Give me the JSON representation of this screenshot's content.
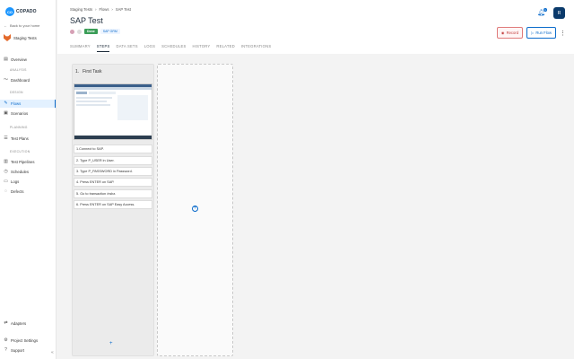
{
  "brand": {
    "logo_mark": "CO",
    "logo_text": "COPADO"
  },
  "sidebar": {
    "back_label": "Back to your home",
    "project_name": "Staging Tests",
    "sections": {
      "analysis": "ANALYSIS",
      "design": "DESIGN",
      "planning": "PLANNING",
      "execution": "EXECUTION"
    },
    "items": [
      {
        "label": "Overview",
        "icon": "overview-icon"
      },
      {
        "label": "Dashboard",
        "icon": "dashboard-icon"
      },
      {
        "label": "Flows",
        "icon": "flows-icon",
        "active": true
      },
      {
        "label": "Scenarios",
        "icon": "scenarios-icon"
      },
      {
        "label": "Test Plans",
        "icon": "test-plans-icon"
      },
      {
        "label": "Test Pipelines",
        "icon": "pipelines-icon"
      },
      {
        "label": "Schedules",
        "icon": "schedules-icon"
      },
      {
        "label": "Logs",
        "icon": "logs-icon"
      },
      {
        "label": "Defects",
        "icon": "defects-icon"
      },
      {
        "label": "Adapters",
        "icon": "adapters-icon"
      },
      {
        "label": "Project Settings",
        "icon": "settings-icon"
      },
      {
        "label": "Support",
        "icon": "support-icon"
      }
    ],
    "collapse_glyph": "«"
  },
  "header": {
    "breadcrumbs": [
      "Staging Tests",
      "Flows",
      "SAP Test"
    ],
    "breadcrumb_sep": "›",
    "title": "SAP Test",
    "status_badge": "Done",
    "type_badge": "SAP GRM",
    "tabs": [
      "SUMMARY",
      "STEPS",
      "DATA SETS",
      "LOGS",
      "SCHEDULES",
      "HISTORY",
      "RELATED",
      "INTEGRATIONS"
    ],
    "active_tab": "STEPS",
    "notification_count": "1",
    "avatar_initial": "R",
    "record_label": "Record",
    "run_label": "Run Flow"
  },
  "board": {
    "column_index": "1.",
    "column_title": "First Task",
    "steps": [
      "1.Connect to SAP.",
      "2. Type P_USER in User.",
      "3. Type P_PASSWORD in Password.",
      "4. Press ENTER on SAP.",
      "5. Go to transaction /nsbz.",
      "6. Press ENTER on SAP Easy Access."
    ],
    "add_step_glyph": "+",
    "add_column_glyph": "+"
  },
  "colors": {
    "accent": "#0b6bcb",
    "active_bg": "#e3f1ff",
    "done": "#3a9d57",
    "record": "#c23b3b"
  }
}
